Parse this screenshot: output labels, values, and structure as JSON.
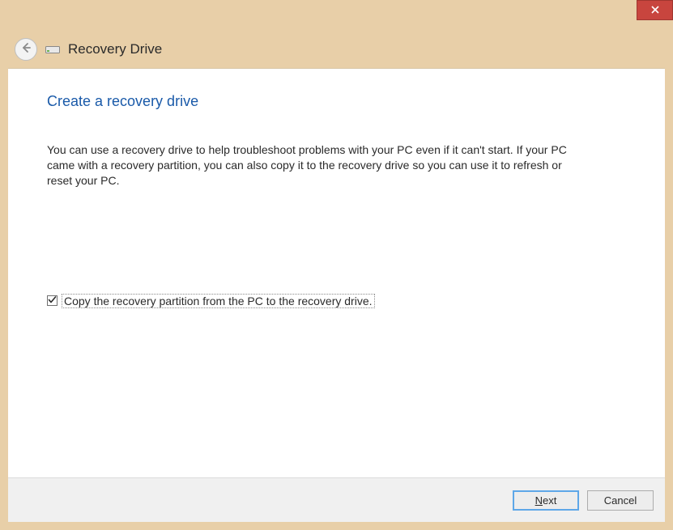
{
  "window": {
    "title": "Recovery Drive"
  },
  "page": {
    "heading": "Create a recovery drive",
    "description": "You can use a recovery drive to help troubleshoot problems with your PC even if it can't start. If your PC came with a recovery partition, you can also copy it to the recovery drive so you can use it to refresh or reset your PC."
  },
  "checkbox": {
    "label": "Copy the recovery partition from the PC to the recovery drive.",
    "checked": true
  },
  "buttons": {
    "next": "Next",
    "cancel": "Cancel"
  }
}
